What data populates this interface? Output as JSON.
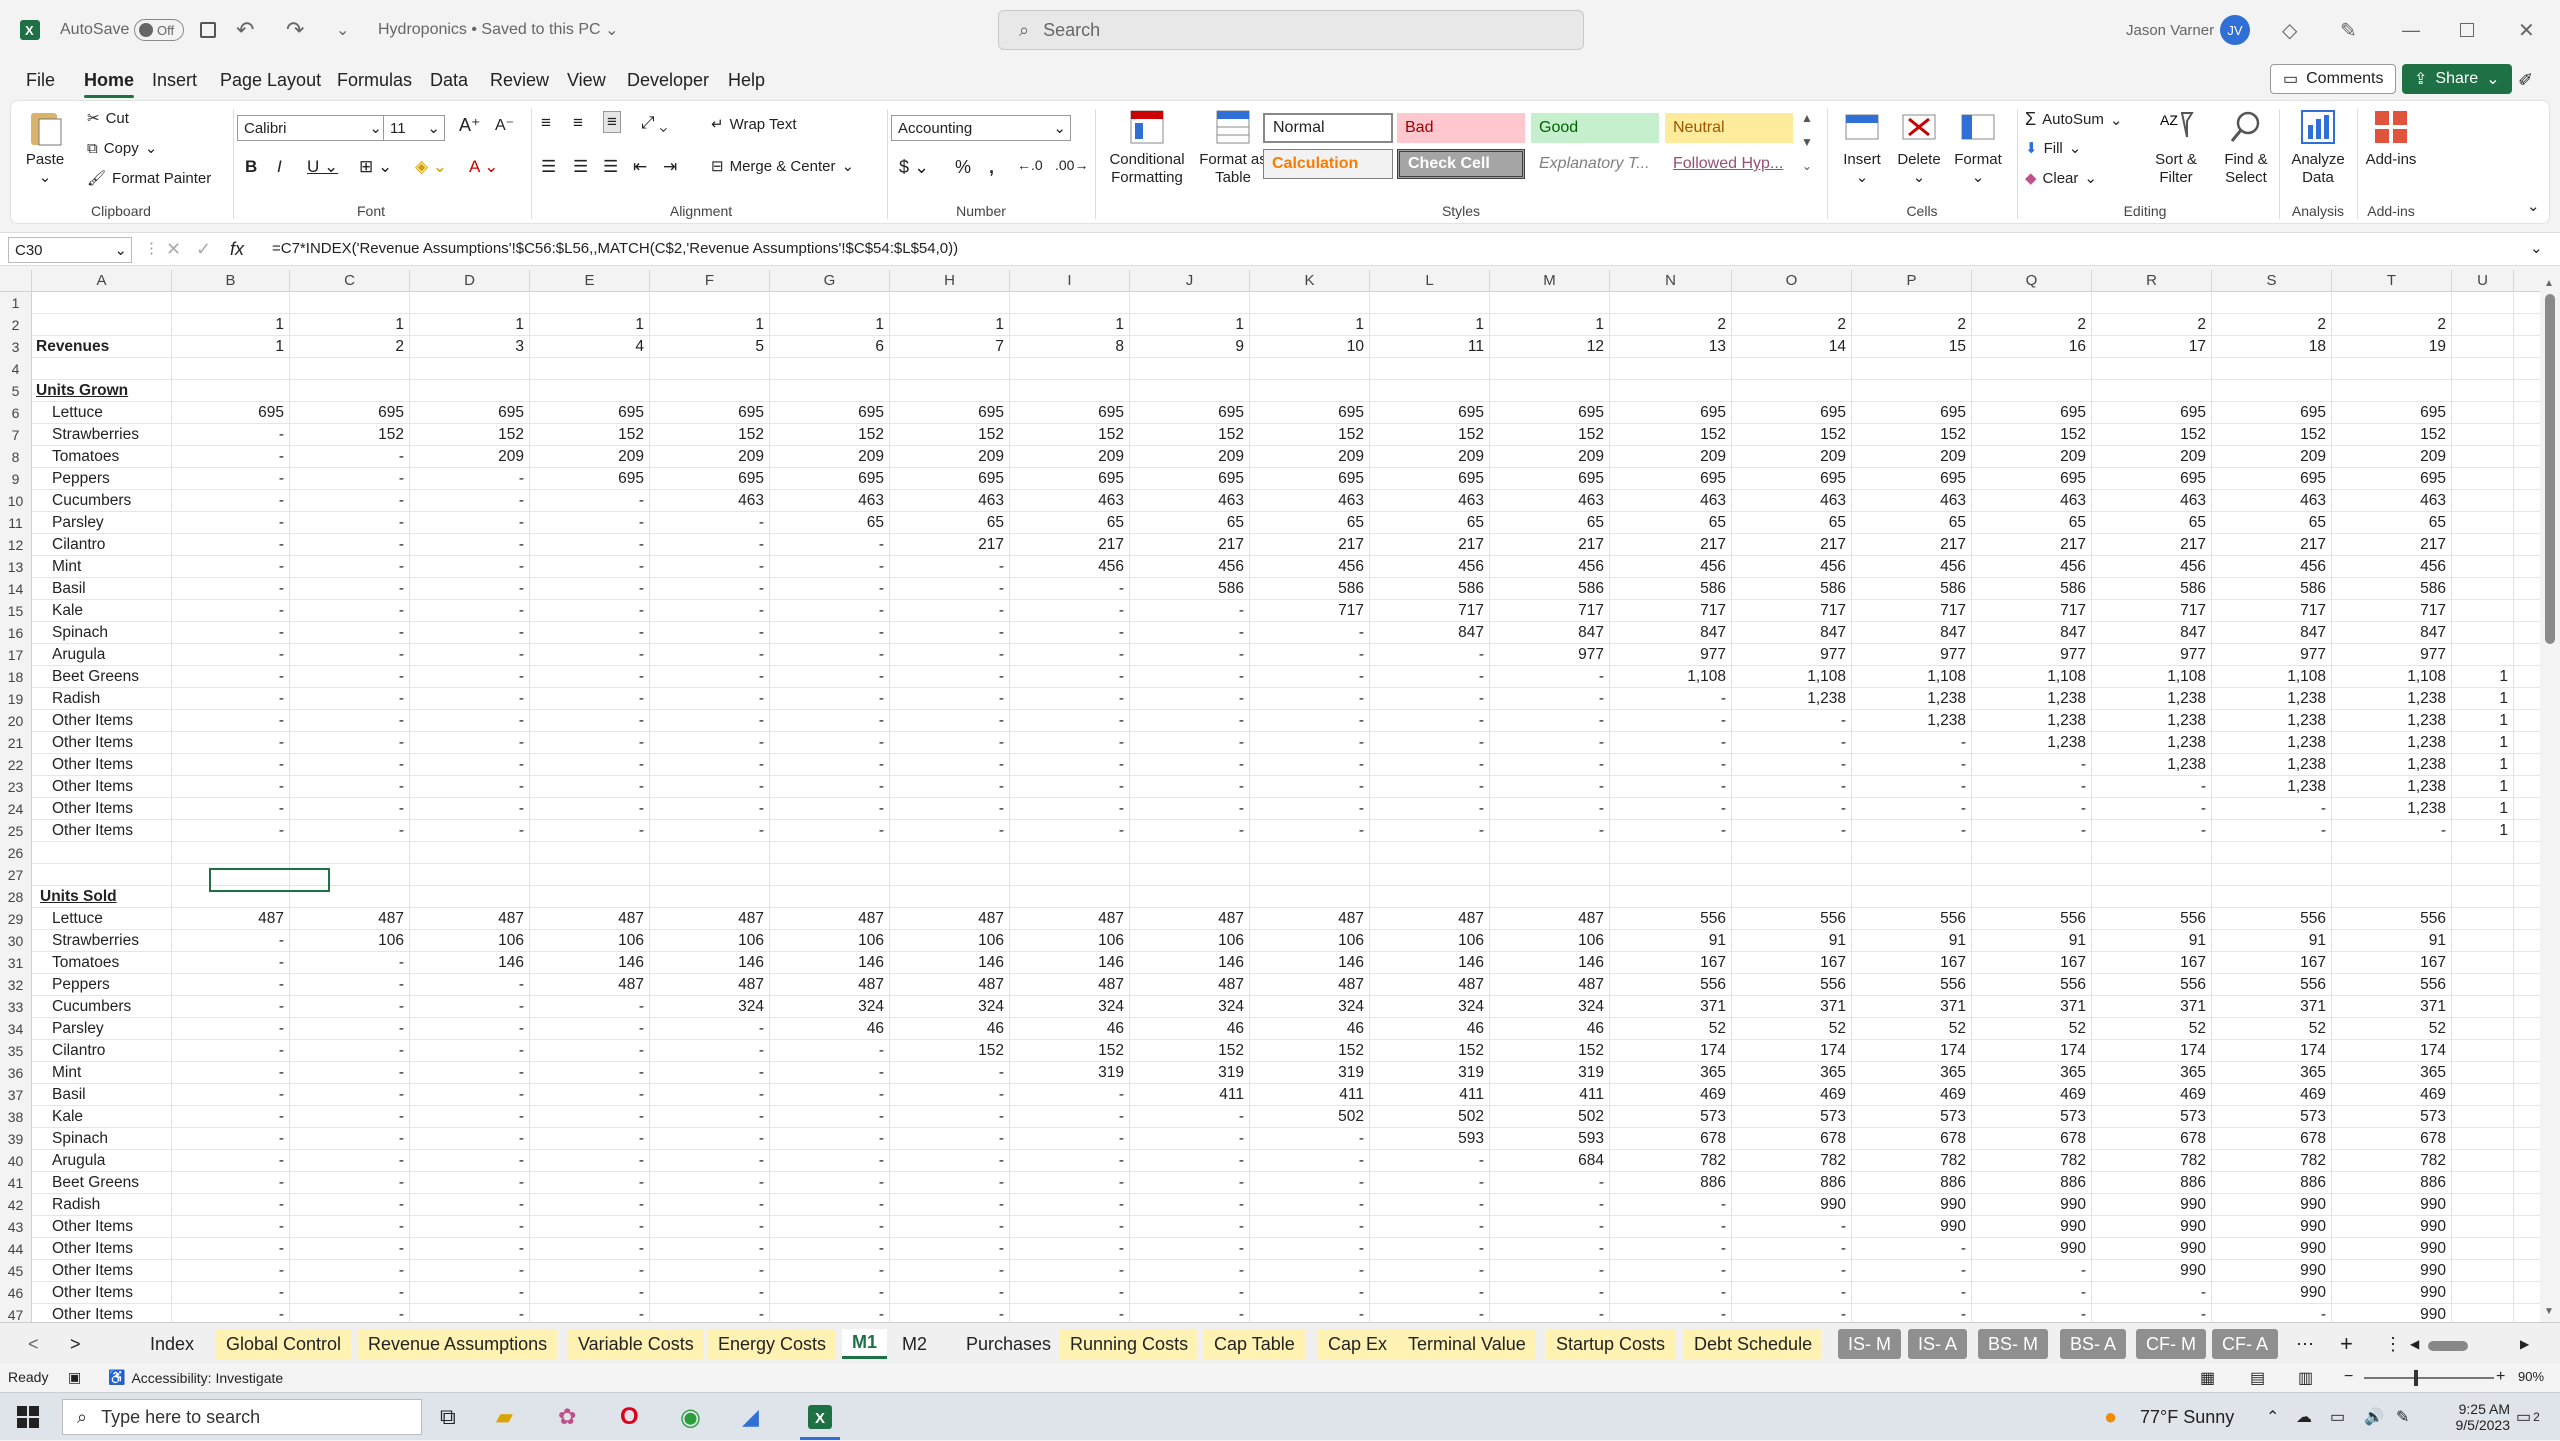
{
  "titlebar": {
    "autosave": "AutoSave",
    "autosave_state": "Off",
    "title": "Hydroponics • Saved to this PC",
    "search": "Search",
    "user": "Jason Varner",
    "initials": "JV"
  },
  "menu": [
    "File",
    "Home",
    "Insert",
    "Page Layout",
    "Formulas",
    "Data",
    "Review",
    "View",
    "Developer",
    "Help"
  ],
  "comments": "Comments",
  "share": "Share",
  "ribbon": {
    "paste": "Paste",
    "cut": "Cut",
    "copy": "Copy",
    "format_painter": "Format Painter",
    "clipboard": "Clipboard",
    "font_name": "Calibri",
    "font_size": "11",
    "font": "Font",
    "wrap_text": "Wrap Text",
    "merge_center": "Merge & Center",
    "alignment": "Alignment",
    "number_format": "Accounting",
    "number": "Number",
    "cond_fmt": "Conditional Formatting",
    "fmt_table": "Format as Table",
    "styles_label": "Styles",
    "normal": "Normal",
    "bad": "Bad",
    "good": "Good",
    "neutral": "Neutral",
    "calculation": "Calculation",
    "check_cell": "Check Cell",
    "explanatory": "Explanatory T...",
    "followed": "Followed Hyp...",
    "insert": "Insert",
    "delete": "Delete",
    "format": "Format",
    "cells": "Cells",
    "autosum": "AutoSum",
    "fill": "Fill",
    "clear": "Clear",
    "sort_filter": "Sort & Filter",
    "find_select": "Find & Select",
    "editing": "Editing",
    "analyze": "Analyze Data",
    "analysis": "Analysis",
    "addins": "Add-ins",
    "addins_grp": "Add-ins"
  },
  "formula_bar": {
    "name_box": "C30",
    "fx": "fx",
    "formula": "=C7*INDEX('Revenue Assumptions'!$C56:$L56,,MATCH(C$2,'Revenue Assumptions'!$C$54:$L$54,0))"
  },
  "columns": [
    "A",
    "B",
    "C",
    "D",
    "E",
    "F",
    "G",
    "H",
    "I",
    "J",
    "K",
    "L",
    "M",
    "N",
    "O",
    "P",
    "Q",
    "R",
    "S",
    "T",
    "U"
  ],
  "sheet_rows": [
    {
      "n": "1",
      "a": "",
      "v": []
    },
    {
      "n": "2",
      "a": "",
      "v": [
        "1",
        "1",
        "1",
        "1",
        "1",
        "1",
        "1",
        "1",
        "1",
        "1",
        "1",
        "1",
        "2",
        "2",
        "2",
        "2",
        "2",
        "2",
        "2"
      ]
    },
    {
      "n": "3",
      "a": "Revenues",
      "bold": true,
      "v": [
        "1",
        "2",
        "3",
        "4",
        "5",
        "6",
        "7",
        "8",
        "9",
        "10",
        "11",
        "12",
        "13",
        "14",
        "15",
        "16",
        "17",
        "18",
        "19"
      ]
    },
    {
      "n": "4",
      "a": "",
      "v": []
    },
    {
      "n": "5",
      "a": "Units Grown",
      "bold": true,
      "u": true,
      "v": []
    },
    {
      "n": "6",
      "a": "Lettuce",
      "v": [
        "695",
        "695",
        "695",
        "695",
        "695",
        "695",
        "695",
        "695",
        "695",
        "695",
        "695",
        "695",
        "695",
        "695",
        "695",
        "695",
        "695",
        "695",
        "695"
      ]
    },
    {
      "n": "7",
      "a": "Strawberries",
      "v": [
        "-",
        "152",
        "152",
        "152",
        "152",
        "152",
        "152",
        "152",
        "152",
        "152",
        "152",
        "152",
        "152",
        "152",
        "152",
        "152",
        "152",
        "152",
        "152"
      ]
    },
    {
      "n": "8",
      "a": "Tomatoes",
      "v": [
        "-",
        "-",
        "209",
        "209",
        "209",
        "209",
        "209",
        "209",
        "209",
        "209",
        "209",
        "209",
        "209",
        "209",
        "209",
        "209",
        "209",
        "209",
        "209"
      ]
    },
    {
      "n": "9",
      "a": "Peppers",
      "v": [
        "-",
        "-",
        "-",
        "695",
        "695",
        "695",
        "695",
        "695",
        "695",
        "695",
        "695",
        "695",
        "695",
        "695",
        "695",
        "695",
        "695",
        "695",
        "695"
      ]
    },
    {
      "n": "10",
      "a": "Cucumbers",
      "v": [
        "-",
        "-",
        "-",
        "-",
        "463",
        "463",
        "463",
        "463",
        "463",
        "463",
        "463",
        "463",
        "463",
        "463",
        "463",
        "463",
        "463",
        "463",
        "463"
      ]
    },
    {
      "n": "11",
      "a": "Parsley",
      "v": [
        "-",
        "-",
        "-",
        "-",
        "-",
        "65",
        "65",
        "65",
        "65",
        "65",
        "65",
        "65",
        "65",
        "65",
        "65",
        "65",
        "65",
        "65",
        "65"
      ]
    },
    {
      "n": "12",
      "a": "Cilantro",
      "v": [
        "-",
        "-",
        "-",
        "-",
        "-",
        "-",
        "217",
        "217",
        "217",
        "217",
        "217",
        "217",
        "217",
        "217",
        "217",
        "217",
        "217",
        "217",
        "217"
      ]
    },
    {
      "n": "13",
      "a": "Mint",
      "v": [
        "-",
        "-",
        "-",
        "-",
        "-",
        "-",
        "-",
        "456",
        "456",
        "456",
        "456",
        "456",
        "456",
        "456",
        "456",
        "456",
        "456",
        "456",
        "456"
      ]
    },
    {
      "n": "14",
      "a": "Basil",
      "v": [
        "-",
        "-",
        "-",
        "-",
        "-",
        "-",
        "-",
        "-",
        "586",
        "586",
        "586",
        "586",
        "586",
        "586",
        "586",
        "586",
        "586",
        "586",
        "586"
      ]
    },
    {
      "n": "15",
      "a": "Kale",
      "v": [
        "-",
        "-",
        "-",
        "-",
        "-",
        "-",
        "-",
        "-",
        "-",
        "717",
        "717",
        "717",
        "717",
        "717",
        "717",
        "717",
        "717",
        "717",
        "717"
      ]
    },
    {
      "n": "16",
      "a": "Spinach",
      "v": [
        "-",
        "-",
        "-",
        "-",
        "-",
        "-",
        "-",
        "-",
        "-",
        "-",
        "847",
        "847",
        "847",
        "847",
        "847",
        "847",
        "847",
        "847",
        "847"
      ]
    },
    {
      "n": "17",
      "a": "Arugula",
      "v": [
        "-",
        "-",
        "-",
        "-",
        "-",
        "-",
        "-",
        "-",
        "-",
        "-",
        "-",
        "977",
        "977",
        "977",
        "977",
        "977",
        "977",
        "977",
        "977"
      ]
    },
    {
      "n": "18",
      "a": "Beet Greens",
      "v": [
        "-",
        "-",
        "-",
        "-",
        "-",
        "-",
        "-",
        "-",
        "-",
        "-",
        "-",
        "-",
        "1,108",
        "1,108",
        "1,108",
        "1,108",
        "1,108",
        "1,108",
        "1,108"
      ],
      "u2": "1"
    },
    {
      "n": "19",
      "a": "Radish",
      "v": [
        "-",
        "-",
        "-",
        "-",
        "-",
        "-",
        "-",
        "-",
        "-",
        "-",
        "-",
        "-",
        "-",
        "1,238",
        "1,238",
        "1,238",
        "1,238",
        "1,238",
        "1,238"
      ],
      "u2": "1"
    },
    {
      "n": "20",
      "a": "Other Items",
      "v": [
        "-",
        "-",
        "-",
        "-",
        "-",
        "-",
        "-",
        "-",
        "-",
        "-",
        "-",
        "-",
        "-",
        "-",
        "1,238",
        "1,238",
        "1,238",
        "1,238",
        "1,238"
      ],
      "u2": "1"
    },
    {
      "n": "21",
      "a": "Other Items",
      "v": [
        "-",
        "-",
        "-",
        "-",
        "-",
        "-",
        "-",
        "-",
        "-",
        "-",
        "-",
        "-",
        "-",
        "-",
        "-",
        "1,238",
        "1,238",
        "1,238",
        "1,238"
      ],
      "u2": "1"
    },
    {
      "n": "22",
      "a": "Other Items",
      "v": [
        "-",
        "-",
        "-",
        "-",
        "-",
        "-",
        "-",
        "-",
        "-",
        "-",
        "-",
        "-",
        "-",
        "-",
        "-",
        "-",
        "1,238",
        "1,238",
        "1,238"
      ],
      "u2": "1"
    },
    {
      "n": "23",
      "a": "Other Items",
      "v": [
        "-",
        "-",
        "-",
        "-",
        "-",
        "-",
        "-",
        "-",
        "-",
        "-",
        "-",
        "-",
        "-",
        "-",
        "-",
        "-",
        "-",
        "1,238",
        "1,238"
      ],
      "u2": "1"
    },
    {
      "n": "24",
      "a": "Other Items",
      "v": [
        "-",
        "-",
        "-",
        "-",
        "-",
        "-",
        "-",
        "-",
        "-",
        "-",
        "-",
        "-",
        "-",
        "-",
        "-",
        "-",
        "-",
        "-",
        "1,238"
      ],
      "u2": "1"
    },
    {
      "n": "25",
      "a": "Other Items",
      "v": [
        "-",
        "-",
        "-",
        "-",
        "-",
        "-",
        "-",
        "-",
        "-",
        "-",
        "-",
        "-",
        "-",
        "-",
        "-",
        "-",
        "-",
        "-",
        "-"
      ],
      "u2": "1"
    },
    {
      "n": "26",
      "a": "",
      "v": []
    },
    {
      "n": "27",
      "a": "",
      "v": []
    },
    {
      "n": "28",
      "a": "Units Sold",
      "bold": true,
      "u": true,
      "v": []
    },
    {
      "n": "29",
      "a": "Lettuce",
      "v": [
        "487",
        "487",
        "487",
        "487",
        "487",
        "487",
        "487",
        "487",
        "487",
        "487",
        "487",
        "487",
        "556",
        "556",
        "556",
        "556",
        "556",
        "556",
        "556"
      ]
    },
    {
      "n": "30",
      "a": "Strawberries",
      "v": [
        "-",
        "106",
        "106",
        "106",
        "106",
        "106",
        "106",
        "106",
        "106",
        "106",
        "106",
        "106",
        "91",
        "91",
        "91",
        "91",
        "91",
        "91",
        "91"
      ]
    },
    {
      "n": "31",
      "a": "Tomatoes",
      "v": [
        "-",
        "-",
        "146",
        "146",
        "146",
        "146",
        "146",
        "146",
        "146",
        "146",
        "146",
        "146",
        "167",
        "167",
        "167",
        "167",
        "167",
        "167",
        "167"
      ]
    },
    {
      "n": "32",
      "a": "Peppers",
      "v": [
        "-",
        "-",
        "-",
        "487",
        "487",
        "487",
        "487",
        "487",
        "487",
        "487",
        "487",
        "487",
        "556",
        "556",
        "556",
        "556",
        "556",
        "556",
        "556"
      ]
    },
    {
      "n": "33",
      "a": "Cucumbers",
      "v": [
        "-",
        "-",
        "-",
        "-",
        "324",
        "324",
        "324",
        "324",
        "324",
        "324",
        "324",
        "324",
        "371",
        "371",
        "371",
        "371",
        "371",
        "371",
        "371"
      ]
    },
    {
      "n": "34",
      "a": "Parsley",
      "v": [
        "-",
        "-",
        "-",
        "-",
        "-",
        "46",
        "46",
        "46",
        "46",
        "46",
        "46",
        "46",
        "52",
        "52",
        "52",
        "52",
        "52",
        "52",
        "52"
      ]
    },
    {
      "n": "35",
      "a": "Cilantro",
      "v": [
        "-",
        "-",
        "-",
        "-",
        "-",
        "-",
        "152",
        "152",
        "152",
        "152",
        "152",
        "152",
        "174",
        "174",
        "174",
        "174",
        "174",
        "174",
        "174"
      ]
    },
    {
      "n": "36",
      "a": "Mint",
      "v": [
        "-",
        "-",
        "-",
        "-",
        "-",
        "-",
        "-",
        "319",
        "319",
        "319",
        "319",
        "319",
        "365",
        "365",
        "365",
        "365",
        "365",
        "365",
        "365"
      ]
    },
    {
      "n": "37",
      "a": "Basil",
      "v": [
        "-",
        "-",
        "-",
        "-",
        "-",
        "-",
        "-",
        "-",
        "411",
        "411",
        "411",
        "411",
        "469",
        "469",
        "469",
        "469",
        "469",
        "469",
        "469"
      ]
    },
    {
      "n": "38",
      "a": "Kale",
      "v": [
        "-",
        "-",
        "-",
        "-",
        "-",
        "-",
        "-",
        "-",
        "-",
        "502",
        "502",
        "502",
        "573",
        "573",
        "573",
        "573",
        "573",
        "573",
        "573"
      ]
    },
    {
      "n": "39",
      "a": "Spinach",
      "v": [
        "-",
        "-",
        "-",
        "-",
        "-",
        "-",
        "-",
        "-",
        "-",
        "-",
        "593",
        "593",
        "678",
        "678",
        "678",
        "678",
        "678",
        "678",
        "678"
      ]
    },
    {
      "n": "40",
      "a": "Arugula",
      "v": [
        "-",
        "-",
        "-",
        "-",
        "-",
        "-",
        "-",
        "-",
        "-",
        "-",
        "-",
        "684",
        "782",
        "782",
        "782",
        "782",
        "782",
        "782",
        "782"
      ]
    },
    {
      "n": "41",
      "a": "Beet Greens",
      "v": [
        "-",
        "-",
        "-",
        "-",
        "-",
        "-",
        "-",
        "-",
        "-",
        "-",
        "-",
        "-",
        "886",
        "886",
        "886",
        "886",
        "886",
        "886",
        "886"
      ]
    },
    {
      "n": "42",
      "a": "Radish",
      "v": [
        "-",
        "-",
        "-",
        "-",
        "-",
        "-",
        "-",
        "-",
        "-",
        "-",
        "-",
        "-",
        "-",
        "990",
        "990",
        "990",
        "990",
        "990",
        "990"
      ]
    },
    {
      "n": "43",
      "a": "Other Items",
      "v": [
        "-",
        "-",
        "-",
        "-",
        "-",
        "-",
        "-",
        "-",
        "-",
        "-",
        "-",
        "-",
        "-",
        "-",
        "990",
        "990",
        "990",
        "990",
        "990"
      ]
    },
    {
      "n": "44",
      "a": "Other Items",
      "v": [
        "-",
        "-",
        "-",
        "-",
        "-",
        "-",
        "-",
        "-",
        "-",
        "-",
        "-",
        "-",
        "-",
        "-",
        "-",
        "990",
        "990",
        "990",
        "990"
      ]
    },
    {
      "n": "45",
      "a": "Other Items",
      "v": [
        "-",
        "-",
        "-",
        "-",
        "-",
        "-",
        "-",
        "-",
        "-",
        "-",
        "-",
        "-",
        "-",
        "-",
        "-",
        "-",
        "990",
        "990",
        "990"
      ]
    },
    {
      "n": "46",
      "a": "Other Items",
      "v": [
        "-",
        "-",
        "-",
        "-",
        "-",
        "-",
        "-",
        "-",
        "-",
        "-",
        "-",
        "-",
        "-",
        "-",
        "-",
        "-",
        "-",
        "990",
        "990"
      ]
    },
    {
      "n": "47",
      "a": "Other Items",
      "v": [
        "-",
        "-",
        "-",
        "-",
        "-",
        "-",
        "-",
        "-",
        "-",
        "-",
        "-",
        "-",
        "-",
        "-",
        "-",
        "-",
        "-",
        "-",
        "990"
      ]
    }
  ],
  "tabs": [
    {
      "label": "Index",
      "style": "plain"
    },
    {
      "label": "Global Control",
      "style": "yellow"
    },
    {
      "label": "Revenue Assumptions",
      "style": "yellow"
    },
    {
      "label": "Variable Costs",
      "style": "yellow"
    },
    {
      "label": "Energy Costs",
      "style": "yellow"
    },
    {
      "label": "M1",
      "style": "active"
    },
    {
      "label": "M2",
      "style": "plain"
    },
    {
      "label": "Purchases",
      "style": "plain"
    },
    {
      "label": "Running Costs",
      "style": "yellow"
    },
    {
      "label": "Cap Table",
      "style": "yellow"
    },
    {
      "label": "Cap Ex",
      "style": "yellow"
    },
    {
      "label": "Terminal Value",
      "style": "yellow"
    },
    {
      "label": "Startup Costs",
      "style": "yellow"
    },
    {
      "label": "Debt Schedule",
      "style": "yellow"
    },
    {
      "label": "IS- M",
      "style": "gray"
    },
    {
      "label": "IS- A",
      "style": "gray"
    },
    {
      "label": "BS- M",
      "style": "gray"
    },
    {
      "label": "BS- A",
      "style": "gray"
    },
    {
      "label": "CF- M",
      "style": "gray"
    },
    {
      "label": "CF- A",
      "style": "gray"
    }
  ],
  "status": {
    "ready": "Ready",
    "accessibility": "Accessibility: Investigate",
    "zoom": "90%"
  },
  "taskbar": {
    "search": "Type here to search",
    "weather": "77°F  Sunny",
    "time": "9:25 AM",
    "date": "9/5/2023",
    "notif": "2"
  }
}
